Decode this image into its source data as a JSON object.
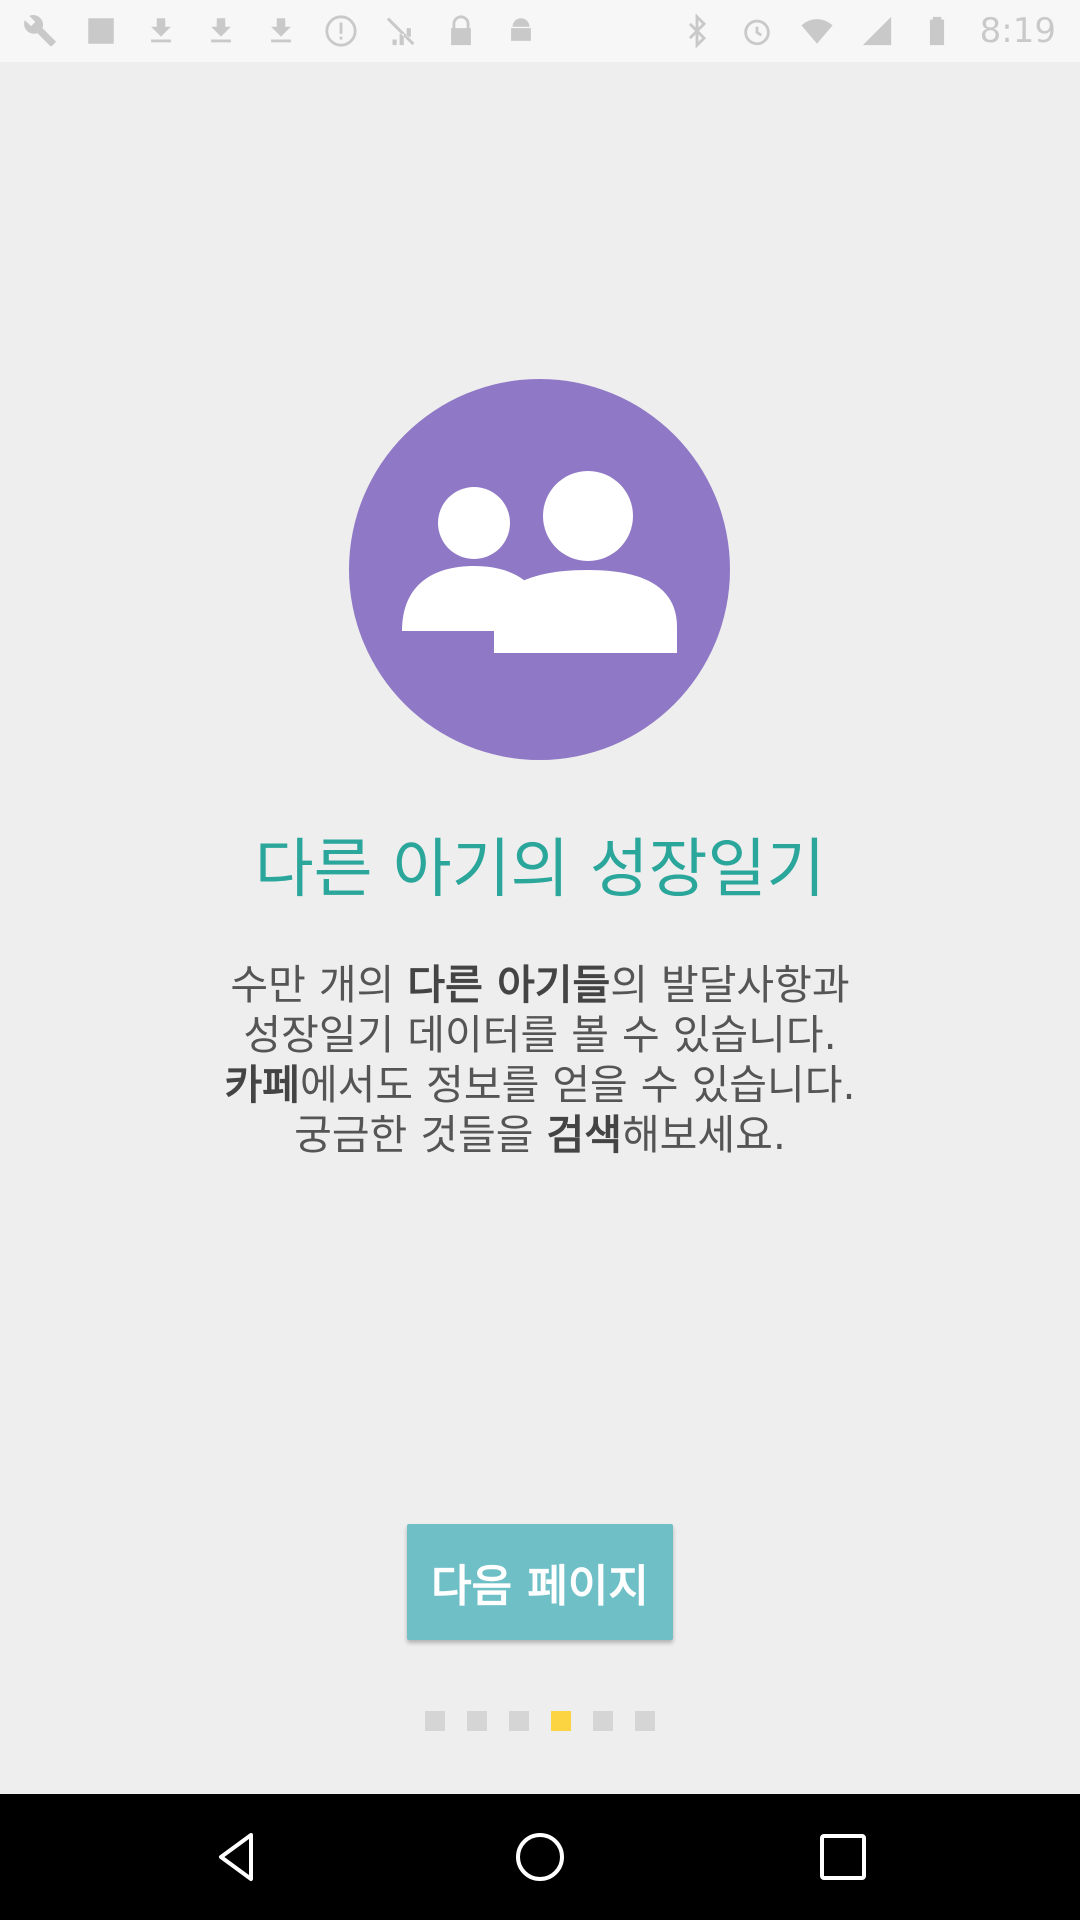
{
  "status_bar": {
    "time": "8:19",
    "left_icons": [
      "wrench-icon",
      "image-icon",
      "download-icon",
      "download-icon",
      "download-icon",
      "alert-icon",
      "signal-off-icon",
      "lock-icon",
      "android-icon"
    ],
    "right_icons": [
      "bluetooth-icon",
      "alarm-icon",
      "wifi-icon",
      "cell-signal-icon",
      "battery-icon"
    ]
  },
  "hero": {
    "icon": "group-icon",
    "color": "#8f78c5"
  },
  "title": "다른 아기의 성장일기",
  "title_color": "#2aa69b",
  "description": {
    "line1": {
      "a": "수만 개의 ",
      "b_bold": "다른 아기들",
      "c": "의 발달사항과"
    },
    "line2": "성장일기 데이터를 볼 수 있습니다.",
    "line3": {
      "a_bold": "카페",
      "b": "에서도 정보를 얻을 수 있습니다."
    },
    "line4": {
      "a": "궁금한 것들을 ",
      "b_bold": "검색",
      "c": "해보세요."
    }
  },
  "next_button": {
    "label": "다음 페이지",
    "color": "#6fbfc7"
  },
  "pager": {
    "count": 6,
    "active_index": 3,
    "active_color": "#fcd340",
    "inactive_color": "#d5d5d5"
  },
  "nav_bar": {
    "buttons": [
      "back-icon",
      "home-icon",
      "recents-icon"
    ]
  }
}
